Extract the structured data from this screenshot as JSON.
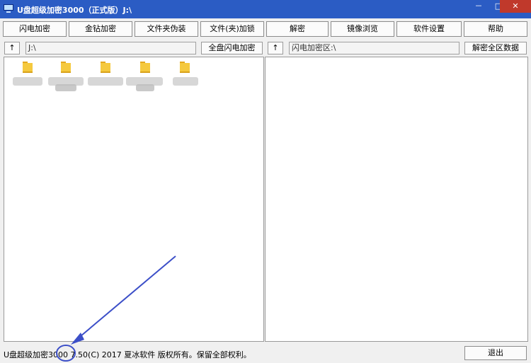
{
  "window": {
    "title": "U盘超级加密3000（正式版）J:\\",
    "min": "－",
    "max": "□",
    "close": "✕"
  },
  "toolbar": [
    {
      "label": "闪电加密"
    },
    {
      "label": "金钻加密"
    },
    {
      "label": "文件夹伪装"
    },
    {
      "label": "文件(夹)加锁"
    },
    {
      "label": "解密"
    },
    {
      "label": "镜像浏览"
    },
    {
      "label": "软件设置"
    },
    {
      "label": "帮助"
    }
  ],
  "left_pane": {
    "up_label": "↑",
    "path": "J:\\",
    "encrypt_all_label": "全盘闪电加密"
  },
  "right_pane": {
    "up_label": "↑",
    "path": "闪电加密区:\\",
    "decrypt_all_label": "解密全区数据"
  },
  "file_icons": [
    "folder-icon",
    "folder-icon",
    "folder-icon",
    "folder-icon",
    "folder-icon"
  ],
  "status": {
    "text": "U盘超级加密3000 7.50(C) 2017 夏冰软件 版权所有。保留全部权利。",
    "exit_label": "退出"
  },
  "colors": {
    "titlebar": "#2b5cc4",
    "annotation": "#3c4fc8",
    "folder": "#f5c93e"
  }
}
